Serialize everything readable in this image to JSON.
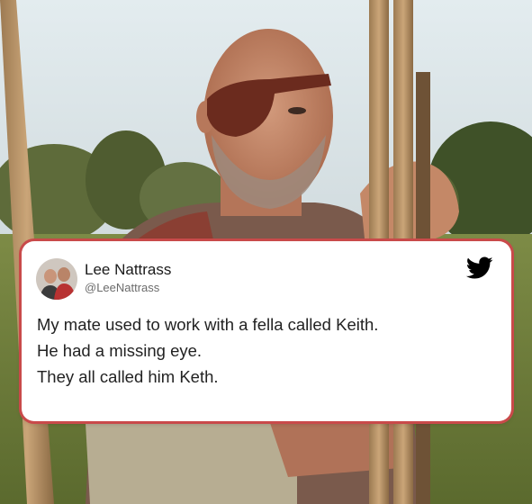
{
  "tweet": {
    "display_name": "Lee Nattrass",
    "handle": "@LeeNattrass",
    "lines": [
      "My mate used to work with a fella called Keith.",
      "He had a missing eye.",
      "They all called him Keth."
    ],
    "brand_icon": "twitter-bird-icon",
    "brand_color": "#000000"
  },
  "colors": {
    "card_border": "#c94a4a",
    "sky": "#dbe6ea",
    "grass": "#6f7f3c"
  }
}
